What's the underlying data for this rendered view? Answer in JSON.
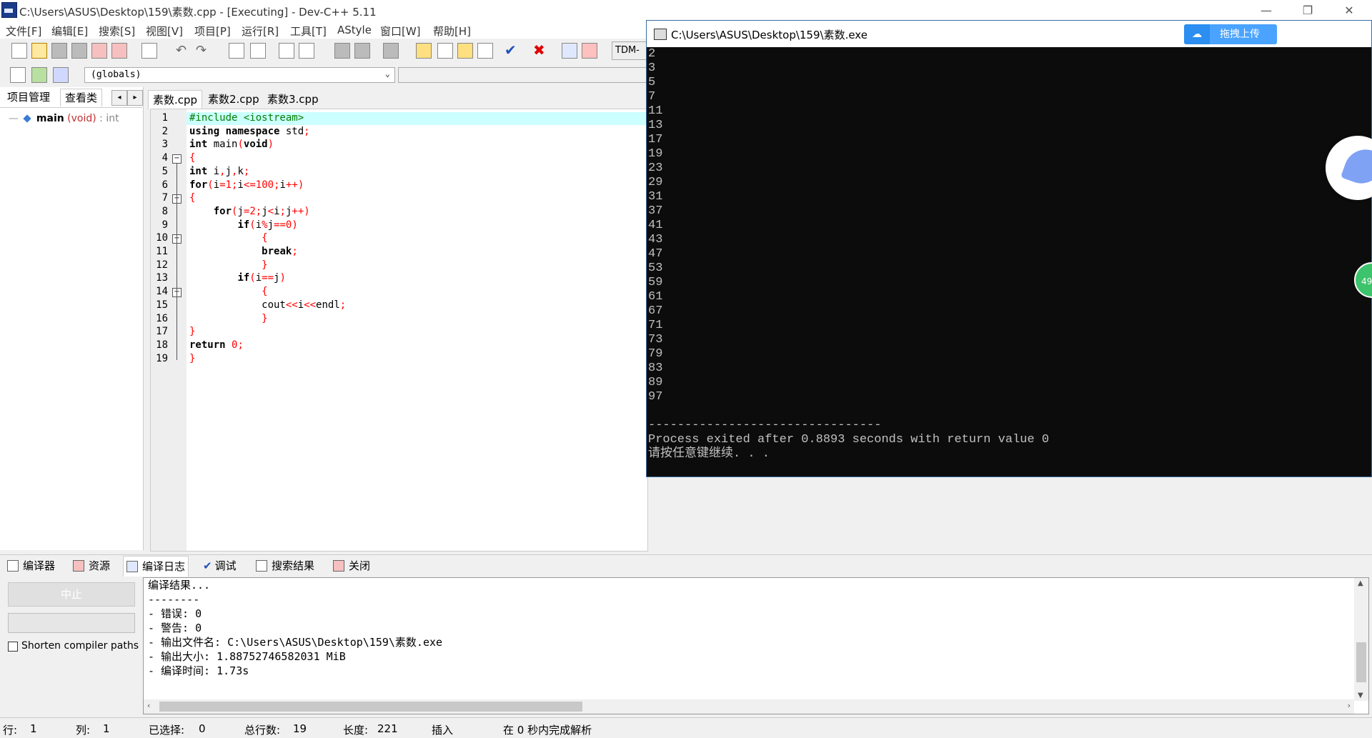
{
  "window": {
    "title": "C:\\Users\\ASUS\\Desktop\\159\\素数.cpp - [Executing] - Dev-C++ 5.11",
    "minimize": "—",
    "restore": "❐",
    "close": "✕"
  },
  "menu": [
    "文件[F]",
    "编辑[E]",
    "搜索[S]",
    "视图[V]",
    "项目[P]",
    "运行[R]",
    "工具[T]",
    "AStyle",
    "窗口[W]",
    "帮助[H]"
  ],
  "toolbar": {
    "compiler_label": "TDM-GC"
  },
  "globals_select": "(globals)",
  "left_panel": {
    "tabs": [
      "项目管理",
      "查看类"
    ],
    "active_tab": 1,
    "tree_item": {
      "name": "main",
      "args": " (void)",
      "type": " : int"
    }
  },
  "editor_tabs": [
    "素数.cpp",
    "素数2.cpp",
    "素数3.cpp"
  ],
  "code_lines": [
    "#include <iostream>",
    "using namespace std;",
    "int main(void)",
    "{",
    "int i,j,k;",
    "for(i=1;i<=100;i++)",
    "{",
    "    for(j=2;j<i;j++)",
    "        if(i%j==0)",
    "            {",
    "            break;",
    "            }",
    "        if(i==j)",
    "            {",
    "            cout<<i<<endl;",
    "            }",
    "}",
    "return 0;",
    "}"
  ],
  "console": {
    "title": "C:\\Users\\ASUS\\Desktop\\159\\素数.exe",
    "upload_label": "拖拽上传",
    "output": [
      "2",
      "3",
      "5",
      "7",
      "11",
      "13",
      "17",
      "19",
      "23",
      "29",
      "31",
      "37",
      "41",
      "43",
      "47",
      "53",
      "59",
      "61",
      "67",
      "71",
      "73",
      "79",
      "83",
      "89",
      "97",
      "",
      "--------------------------------",
      "Process exited after 0.8893 seconds with return value 0",
      "请按任意键继续. . ."
    ],
    "badge": "49"
  },
  "bottom_tabs": [
    "编译器",
    "资源",
    "编译日志",
    "调试",
    "搜索结果",
    "关闭"
  ],
  "bottom_active_tab": 2,
  "bottom_panel": {
    "stop_label": "中止",
    "shorten_label": "Shorten compiler paths",
    "log": [
      "编译结果...",
      "--------",
      "- 错误: 0",
      "- 警告: 0",
      "- 输出文件名: C:\\Users\\ASUS\\Desktop\\159\\素数.exe",
      "- 输出大小: 1.88752746582031 MiB",
      "- 编译时间: 1.73s"
    ]
  },
  "status": {
    "row_label": "行:",
    "row": "1",
    "col_label": "列:",
    "col": "1",
    "sel_label": "已选择:",
    "sel": "0",
    "lines_label": "总行数:",
    "lines": "19",
    "len_label": "长度:",
    "len": "221",
    "mode": "插入",
    "parse": "在 0 秒内完成解析"
  }
}
